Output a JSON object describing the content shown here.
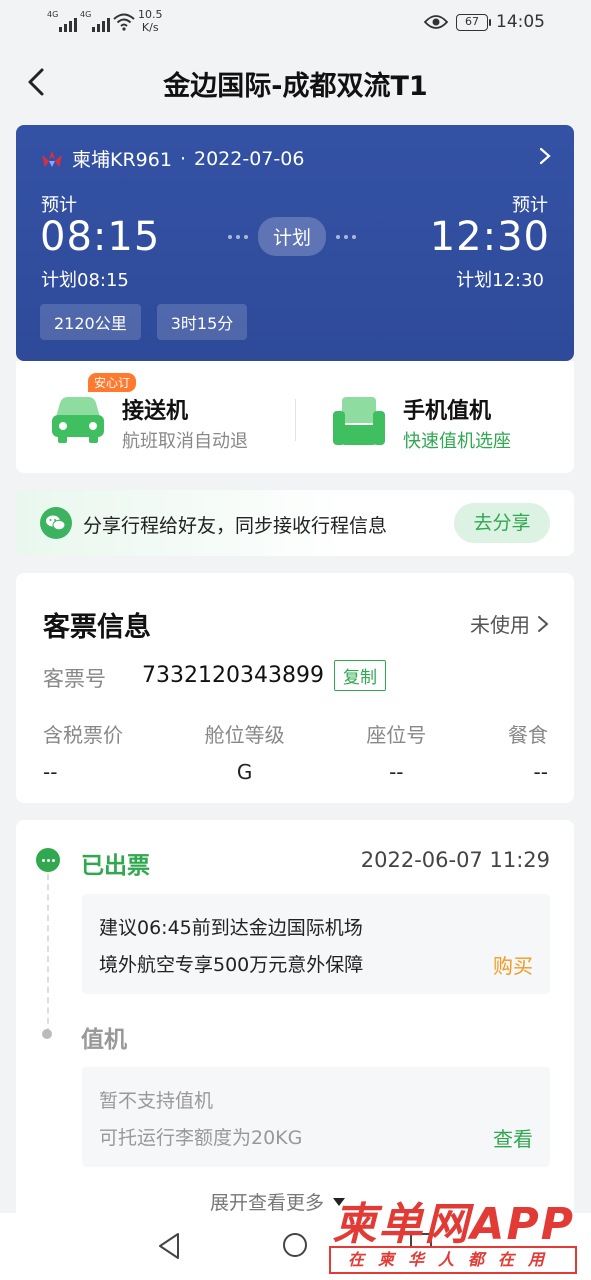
{
  "status_bar": {
    "network_1": "4G",
    "network_2": "4G",
    "speed_value": "10.5",
    "speed_unit": "K/s",
    "battery": "67",
    "time": "14:05"
  },
  "header": {
    "title": "金边国际-成都双流T1"
  },
  "flight": {
    "airline_flight": "柬埔KR961",
    "separator": "·",
    "date": "2022-07-06",
    "dep_label": "预计",
    "dep_time": "08:15",
    "dep_plan": "计划08:15",
    "arr_label": "预计",
    "arr_time": "12:30",
    "arr_plan": "计划12:30",
    "status_pill": "计划",
    "distance": "2120公里",
    "duration": "3时15分"
  },
  "services": {
    "pickup_badge": "安心订",
    "pickup_title": "接送机",
    "pickup_sub": "航班取消自动退",
    "checkin_title": "手机值机",
    "checkin_sub": "快速值机选座"
  },
  "share": {
    "text": "分享行程给好友，同步接收行程信息",
    "button": "去分享"
  },
  "ticket": {
    "title": "客票信息",
    "status": "未使用",
    "number_label": "客票号",
    "number": "7332120343899",
    "copy_label": "复制",
    "columns": [
      {
        "header": "含税票价",
        "value": "--"
      },
      {
        "header": "舱位等级",
        "value": "G"
      },
      {
        "header": "座位号",
        "value": "--"
      },
      {
        "header": "餐食",
        "value": "--"
      }
    ]
  },
  "timeline": {
    "step1_title": "已出票",
    "step1_time": "2022-06-07 11:29",
    "step1_line1": "建议06:45前到达金边国际机场",
    "step1_line2": "境外航空专享500万元意外保障",
    "step1_action": "购买",
    "step2_title": "值机",
    "step2_line1": "暂不支持值机",
    "step2_line2": "可托运行李额度为20KG",
    "step2_action": "查看",
    "expand": "展开查看更多"
  },
  "watermark": {
    "logo_text": "柬单网APP",
    "slogan": "在柬华人都在用"
  },
  "colors": {
    "card_blue": "#3452a5",
    "accent_green": "#2fa84f",
    "accent_orange": "#f39a1e",
    "watermark_red": "#e23b36"
  }
}
